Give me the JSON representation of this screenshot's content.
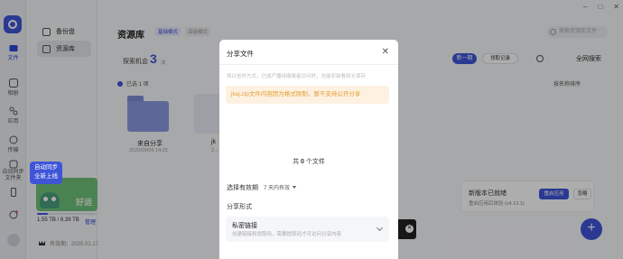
{
  "rail": {
    "items": [
      {
        "label": "文件",
        "icon": "folder-icon"
      },
      {
        "label": "相册",
        "icon": "photo-icon"
      },
      {
        "label": "应用",
        "icon": "apps-icon"
      },
      {
        "label": "传输",
        "icon": "transfer-icon"
      },
      {
        "label": "自动同步文件夹",
        "icon": "sync-folder-icon"
      }
    ]
  },
  "sidebar": {
    "items": [
      {
        "label": "备份盘"
      },
      {
        "label": "资源库"
      }
    ],
    "tooltip_line1": "自动同步",
    "tooltip_line2": "全新上线",
    "promo_text": "好运",
    "storage": "1.55 TB / 8.39 TB",
    "storage_fraction": 0.18,
    "manage": "管理",
    "vip": "有效期：2025.01.17"
  },
  "main": {
    "title": "资源库",
    "badge_basic": "基础模式",
    "badge_adv": "高级模式",
    "search_placeholder": "搜索资源库文件",
    "stat_label": "探索机会",
    "stat_value": "3",
    "stat_unit": "次",
    "btn_primary": "新一期",
    "btn_record": "领取记录",
    "all_search": "全网搜索",
    "filter": "已选 1 项",
    "sort": "按名称排序",
    "folder_name": "来自分享",
    "folder_date": "2023/09/06 14:22",
    "doc_name": "jk",
    "doc_date": "2..."
  },
  "update": {
    "title": "新版本已就绪",
    "desc": "重启应用后体验 (v4.13.1)",
    "restart": "重启应用",
    "ignore": "忽略"
  },
  "modal": {
    "title": "分享文件",
    "hint": "将以省时方式，已成产播待撤离者访问时，也能安装看到无保存",
    "warning": "jkuj.zip文件内容因为格式限制，暂不支持公开分享",
    "count_prefix": "共",
    "count": "0",
    "count_suffix": "个文件",
    "valid_label": "选择有效期",
    "valid_value": "7 天内有效",
    "form_label": "分享形式",
    "option_title": "私密链接",
    "option_desc": "创建链接和提取码，需要提取码才可访问分享内容"
  },
  "colors": {
    "accent": "#3f55d8",
    "warning_text": "#e69a2e",
    "warning_bg": "#fdf2e2"
  }
}
